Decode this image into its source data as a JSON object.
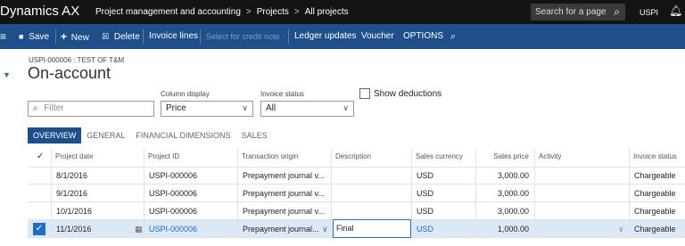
{
  "topbar": {
    "brand": "Dynamics AX",
    "breadcrumbs": [
      "Project management and accounting",
      "Projects",
      "All projects"
    ],
    "breadcrumb_sep": ">",
    "search_placeholder": "Search for a page",
    "user": "USPI"
  },
  "toolbar": {
    "save": "Save",
    "new": "New",
    "delete": "Delete",
    "invoice_lines": "Invoice lines",
    "select_credit": "Select for credit note",
    "ledger_updates": "Ledger updates",
    "voucher": "Voucher",
    "options": "OPTIONS"
  },
  "header": {
    "record_id": "USPI-000006 : TEST OF T&M",
    "title": "On-account"
  },
  "filters": {
    "filter_placeholder": "Filter",
    "column_display_label": "Column display",
    "column_display_value": "Price",
    "invoice_status_label": "Invoice status",
    "invoice_status_value": "All",
    "show_deductions_label": "Show deductions"
  },
  "tabs": [
    "OVERVIEW",
    "GENERAL",
    "FINANCIAL DIMENSIONS",
    "SALES"
  ],
  "grid": {
    "columns": [
      "Project date",
      "Project ID",
      "Transaction origin",
      "Description",
      "Sales currency",
      "Sales price",
      "Activity",
      "Invoice status"
    ],
    "rows": [
      {
        "date": "8/1/2016",
        "project_id": "USPI-000006",
        "origin": "Prepayment journal v...",
        "description": "",
        "currency": "USD",
        "price": "3,000.00",
        "activity": "",
        "status": "Chargeable"
      },
      {
        "date": "9/1/2016",
        "project_id": "USPI-000006",
        "origin": "Prepayment journal v...",
        "description": "",
        "currency": "USD",
        "price": "3,000.00",
        "activity": "",
        "status": "Chargeable"
      },
      {
        "date": "10/1/2016",
        "project_id": "USPI-000006",
        "origin": "Prepayment journal v...",
        "description": "",
        "currency": "USD",
        "price": "3,000.00",
        "activity": "",
        "status": "Chargeable"
      },
      {
        "date": "11/1/2016",
        "project_id": "USPI-000006",
        "origin": "Prepayment journal...",
        "description": "Final",
        "currency": "USD",
        "price": "1,000.00",
        "activity": "",
        "status": "Chargeable"
      }
    ]
  },
  "icons": {
    "search": "search-icon",
    "bell": "bell-icon",
    "menu": "hamburger-icon",
    "save": "save-icon",
    "new": "plus-icon",
    "delete": "trash-icon",
    "filter": "funnel-icon",
    "calendar": "calendar-icon",
    "chevron": "chevron-down-icon",
    "check": "check-icon"
  },
  "colors": {
    "topbar_bg": "#141414",
    "toolbar_bg": "#1e4f8a",
    "accent": "#1e6ec8",
    "selected_row": "#dbe8f6"
  }
}
